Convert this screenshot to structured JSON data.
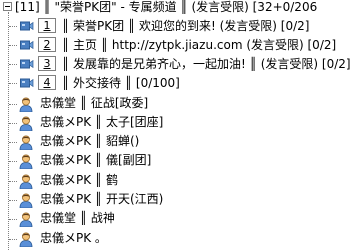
{
  "channel": {
    "label": "[11]  ║ \"荣誉PK团\" - 专属频道  ║  (发言受限) [32+0/206"
  },
  "subchannels": [
    {
      "number": "1",
      "label": "║ 荣誉PK团 ║ 欢迎您的到来! (发言受限) [0/2]"
    },
    {
      "number": "2",
      "label": "║ 主页 ║ http://zytpk.jiazu.com (发言受限) [0/2]"
    },
    {
      "number": "3",
      "label": "║ 发展靠的是兄弟齐心，一起加油! ║ (发言受限) [0/2]"
    },
    {
      "number": "4",
      "label": "║ 外交接待 ║ [0/100]"
    }
  ],
  "users": [
    {
      "name": "忠儀堂 ║ 征战[政委]"
    },
    {
      "name": "忠儀メPK ║ 太子[团座]"
    },
    {
      "name": "忠儀メPK ║ 貂蝉()"
    },
    {
      "name": "忠儀メPK ║ 儀[副团]"
    },
    {
      "name": "忠儀メPK ║ 鹤"
    },
    {
      "name": "忠儀メPK ║ 开天(江西)"
    },
    {
      "name": "忠儀堂 ║ 战神"
    },
    {
      "name": "忠儀メPK 。"
    }
  ],
  "colors": {
    "subchannel_icon": "#4a7fc1",
    "user_icon_face": "#f2c27a",
    "user_icon_body": "#5a8fd8",
    "tree_lines": "#808080"
  }
}
